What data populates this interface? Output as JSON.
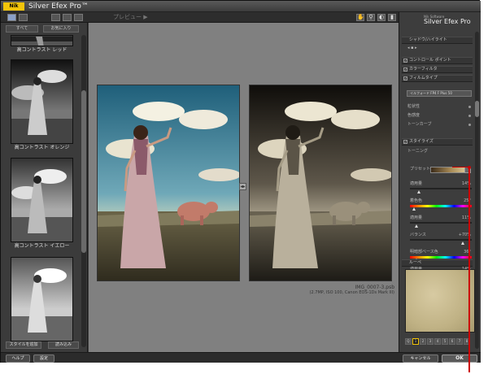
{
  "window": {
    "logo_text": "Nik",
    "title": "Silver Efex Pro™"
  },
  "toolbar": {
    "preview_label": "プレビュー ▶",
    "icons": [
      "hand-tool",
      "zoom-tool",
      "compare",
      "trash"
    ]
  },
  "left_panel": {
    "tabs": [
      "すべて",
      "お気に入り"
    ],
    "presets": [
      {
        "label": "高コントラスト レッド"
      },
      {
        "label": "高コントラスト オレンジ"
      },
      {
        "label": "高コントラスト イエロー"
      },
      {
        "label": ""
      }
    ],
    "add_style_button": "スタイルを追加",
    "import_button": "読み込み"
  },
  "preview": {
    "file_name": "IMG_0007-3.psb",
    "file_info": "(2.7MP, ISO 100, Canon EOS-1Ds Mark III)",
    "divider_icon": "◂▸"
  },
  "right_panel": {
    "brand_sub": "Nik Software",
    "brand": "Silver Efex Pro",
    "sections": {
      "shadow_highlight": "シャドウ/ハイライト",
      "control_point": "コントロール ポイント",
      "color_filter": "カラーフィルタ",
      "film_type": "フィルムタイプ",
      "stylize": "スタイライズ",
      "toning": "トーニング",
      "loupe": "ルーペ"
    },
    "film_dropdown": "イルフォード FP4 F Plus 50",
    "film_subitems": [
      "粒状性",
      "色感度",
      "トーンカーブ"
    ],
    "preset_label": "プリセット",
    "sliders": [
      {
        "label": "適用量",
        "value": "14%",
        "level": 0.14
      },
      {
        "label": "着色色",
        "value": "25°",
        "level": 0.07,
        "hue": true
      },
      {
        "label": "適用量",
        "value": "11%",
        "level": 0.11
      },
      {
        "label": "バランス",
        "value": "+70%",
        "level": 0.85
      },
      {
        "label": "Split-tone 色",
        "value": "36°",
        "level": 0.1,
        "hue": true
      },
      {
        "label": "適用量",
        "value": "14%",
        "level": 0.14
      }
    ],
    "slider_labels_jp": [
      "適用量",
      "着色色",
      "適用量",
      "バランス",
      "明暗部ベース色",
      "適用量"
    ],
    "zoom_levels": [
      "Q",
      "1",
      "2",
      "3",
      "4",
      "5",
      "6",
      "7",
      "8"
    ]
  },
  "bottom_bar": {
    "help": "ヘルプ",
    "settings": "設定",
    "cancel": "キャンセル",
    "ok": "OK"
  },
  "colors": {
    "accent": "#f2c40a",
    "annotation": "#cc0000",
    "panel_bg": "#3d3d3d",
    "preview_bg": "#808080"
  }
}
